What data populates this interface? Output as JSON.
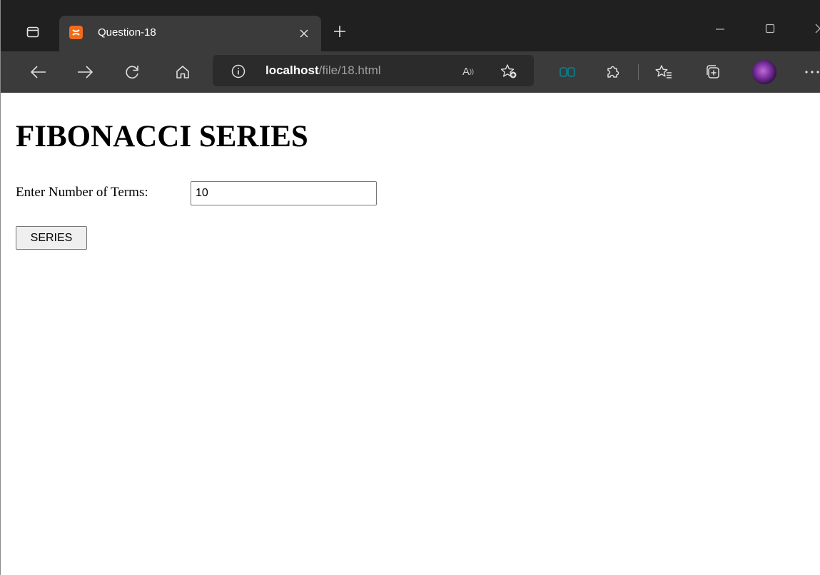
{
  "browser": {
    "tab": {
      "title": "Question-18",
      "favicon": "xampp-icon"
    },
    "address": {
      "host": "localhost",
      "path": "/file/18.html"
    },
    "colors": {
      "titlebar": "#202020",
      "toolbar": "#3b3b3b",
      "favicon": "#f26b1d"
    }
  },
  "page": {
    "heading": "FIBONACCI SERIES",
    "terms_label": "Enter Number of Terms:",
    "terms_value": "10",
    "button_label": "SERIES"
  }
}
